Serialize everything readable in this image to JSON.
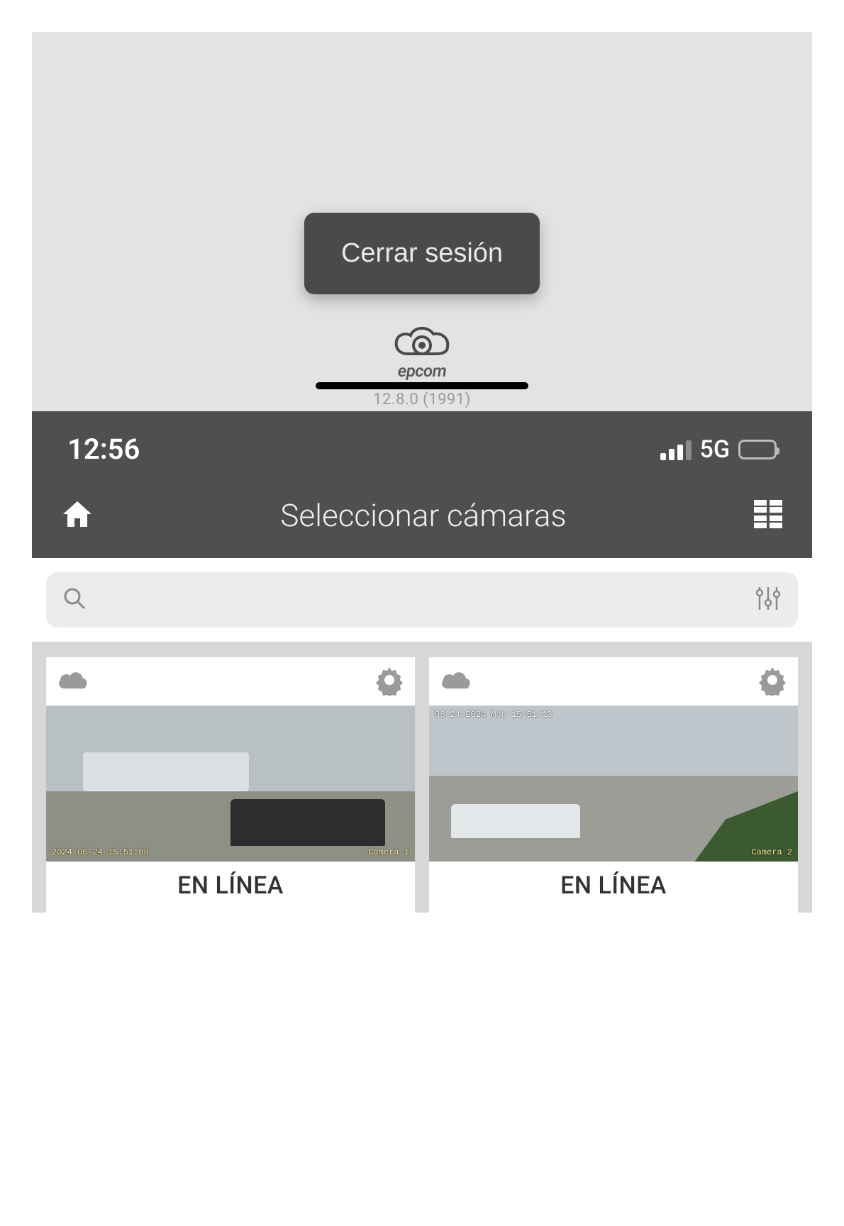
{
  "modal": {
    "logout_label": "Cerrar sesión"
  },
  "brand": {
    "name": "epcom",
    "version": "12.8.0 (1991)"
  },
  "status_bar": {
    "time": "12:56",
    "network": "5G"
  },
  "nav": {
    "title": "Seleccionar cámaras"
  },
  "search": {
    "placeholder": ""
  },
  "cameras": [
    {
      "status": "EN LÍNEA",
      "timestamp": "2024-06-24 15:51:08",
      "camera_label": "Camera 1"
    },
    {
      "status": "EN LÍNEA",
      "timestamp": "06-24-2024 Mon 15:51:13",
      "camera_label": "Camera 2"
    }
  ]
}
